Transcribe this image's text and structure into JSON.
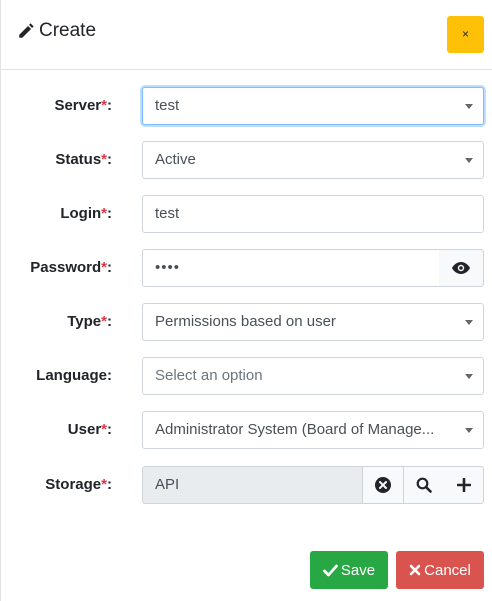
{
  "header": {
    "title": "Create",
    "close_label": "×"
  },
  "form": {
    "required_marker": "*",
    "server": {
      "label": "Server",
      "value": "test"
    },
    "status": {
      "label": "Status",
      "value": "Active"
    },
    "login": {
      "label": "Login",
      "value": "test"
    },
    "password": {
      "label": "Password",
      "value": "••••"
    },
    "type": {
      "label": "Type",
      "value": "Permissions based on user"
    },
    "language": {
      "label": "Language",
      "placeholder": "Select an option"
    },
    "user": {
      "label": "User",
      "value": "Administrator System (Board of Manage..."
    },
    "storage": {
      "label": "Storage",
      "value": "API"
    }
  },
  "footer": {
    "save_label": "Save",
    "cancel_label": "Cancel"
  },
  "colors": {
    "close_button": "#ffc107",
    "save_button": "#28a745",
    "cancel_button": "#d9534f",
    "required": "#dc3545"
  },
  "icons": [
    "pencil-icon",
    "eye-icon",
    "times-circle-icon",
    "search-icon",
    "plus-icon",
    "check-icon",
    "times-icon",
    "chevron-down-icon"
  ]
}
